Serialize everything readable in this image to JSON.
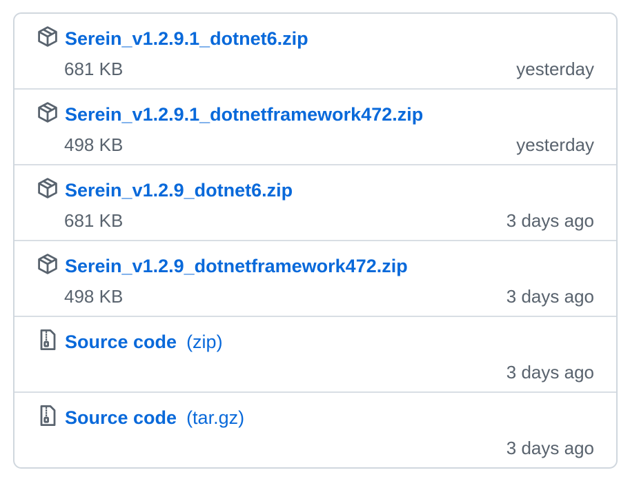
{
  "assets": [
    {
      "name": "Serein_v1.2.9.1_dotnet6.zip",
      "size": "681 KB",
      "updated": "yesterday",
      "icon": "package-icon"
    },
    {
      "name": "Serein_v1.2.9.1_dotnetframework472.zip",
      "size": "498 KB",
      "updated": "yesterday",
      "icon": "package-icon"
    },
    {
      "name": "Serein_v1.2.9_dotnet6.zip",
      "size": "681 KB",
      "updated": "3 days ago",
      "icon": "package-icon"
    },
    {
      "name": "Serein_v1.2.9_dotnetframework472.zip",
      "size": "498 KB",
      "updated": "3 days ago",
      "icon": "package-icon"
    },
    {
      "name": "Source code",
      "suffix": "(zip)",
      "updated": "3 days ago",
      "icon": "file-zip-icon"
    },
    {
      "name": "Source code",
      "suffix": "(tar.gz)",
      "updated": "3 days ago",
      "icon": "file-zip-icon"
    }
  ],
  "colors": {
    "link": "#0969da",
    "muted": "#59636e",
    "border": "#d0d7de",
    "icon": "#59636e"
  }
}
